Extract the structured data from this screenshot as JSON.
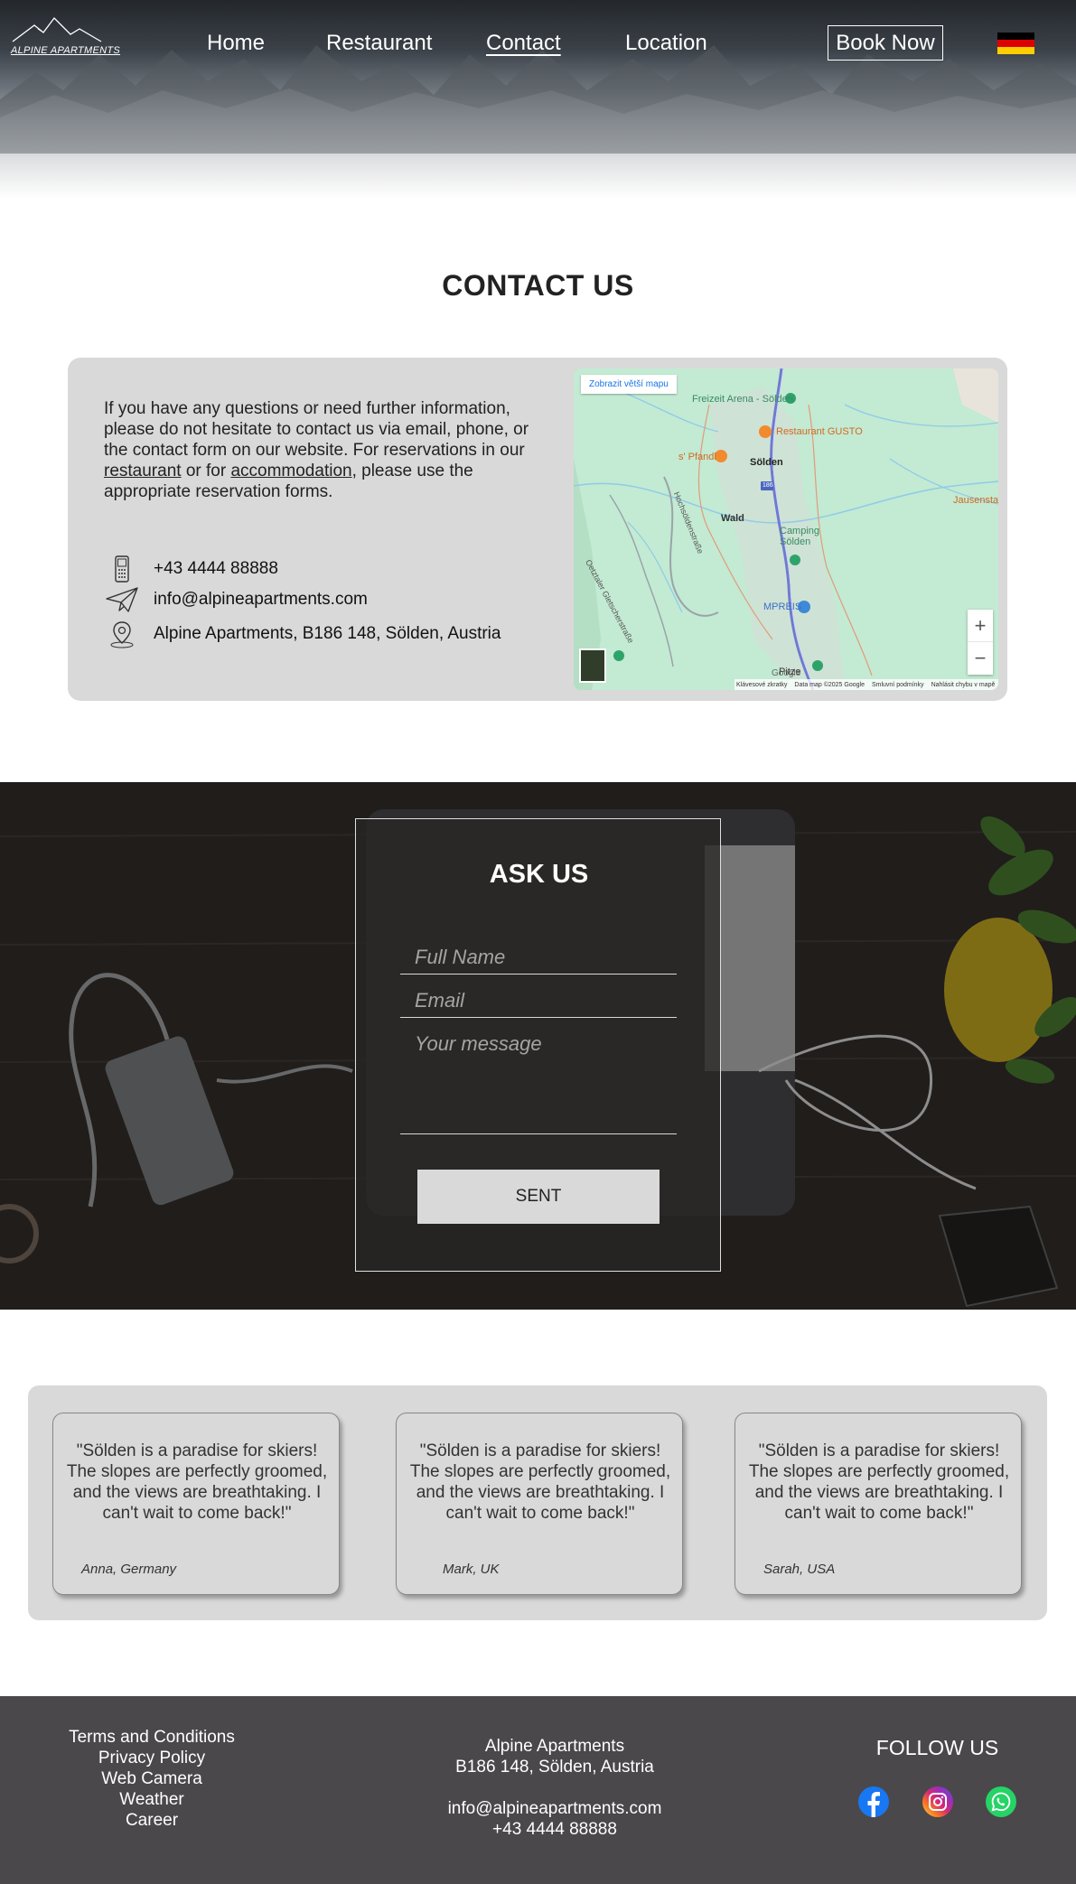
{
  "header": {
    "logo_text": "ALPINE APARTMENTS",
    "nav": [
      {
        "label": "Home",
        "active": false
      },
      {
        "label": "Restaurant",
        "active": false
      },
      {
        "label": "Contact",
        "active": true
      },
      {
        "label": "Location",
        "active": false
      }
    ],
    "book_label": "Book Now",
    "language_flag": "flag-de-icon"
  },
  "contact": {
    "title": "CONTACT US",
    "intro_before": "If you have any questions or need further information, please do not hesitate to contact us via email, phone, or the contact form on our website. For reservations in our ",
    "link_restaurant": "restaurant",
    "intro_middle": " or for ",
    "link_accommodation": "accommodation",
    "intro_after": ", please use the appropriate reservation forms.",
    "phone": "+43 4444 88888",
    "email": "info@alpineapartments.com",
    "address": "Alpine Apartments, B186 148, Sölden, Austria"
  },
  "map": {
    "bigger_map_button": "Zobrazit větší mapu",
    "labels": {
      "freizeit": "Freizeit Arena - Sölden",
      "gusto": "Restaurant GUSTO",
      "pfandl": "s' Pfandl",
      "soelden": "Sölden",
      "wald": "Wald",
      "camping": "Camping Sölden",
      "mpreis": "MPREIS",
      "jausen": "Jausenstatio",
      "road": "186",
      "oetztal": "Oetztaler Gletscherstraße",
      "hochsoelden": "Hochsöldenstraße",
      "pitze": "Pitze",
      "google": "Google"
    },
    "zoom_in": "+",
    "zoom_out": "−",
    "footer": [
      "Klávesové zkratky",
      "Data map ©2025 Google",
      "Smluvní podmínky",
      "Nahlásit chybu v mapě"
    ]
  },
  "ask": {
    "title": "ASK US",
    "name_placeholder": "Full Name",
    "email_placeholder": "Email",
    "message_placeholder": "Your message",
    "submit_label": "SENT"
  },
  "testimonials": [
    {
      "quote": "\"Sölden is a paradise for skiers! The slopes are perfectly groomed, and the views are breathtaking. I can't wait to come back!\"",
      "author": "Anna, Germany"
    },
    {
      "quote": "\"Sölden is a paradise for skiers! The slopes are perfectly groomed, and the views are breathtaking. I can't wait to come back!\"",
      "author": "Mark, UK"
    },
    {
      "quote": "\"Sölden is a paradise for skiers! The slopes are perfectly groomed, and the views are breathtaking. I can't wait to come back!\"",
      "author": "Sarah, USA"
    }
  ],
  "footer": {
    "links": [
      "Terms and Conditions",
      "Privacy Policy",
      "Web Camera",
      "Weather",
      "Career"
    ],
    "company_name": "Alpine Apartments",
    "company_address": "B186 148, Sölden, Austria",
    "email": "info@alpineapartments.com",
    "phone": "+43 4444 88888",
    "follow_title": "FOLLOW US",
    "social": [
      "facebook-icon",
      "instagram-icon",
      "whatsapp-icon"
    ]
  },
  "colors": {
    "card_gray": "#d9d9d9",
    "footer_bg": "#4a484a",
    "facebook": "#1877f2",
    "whatsapp": "#25d366"
  }
}
